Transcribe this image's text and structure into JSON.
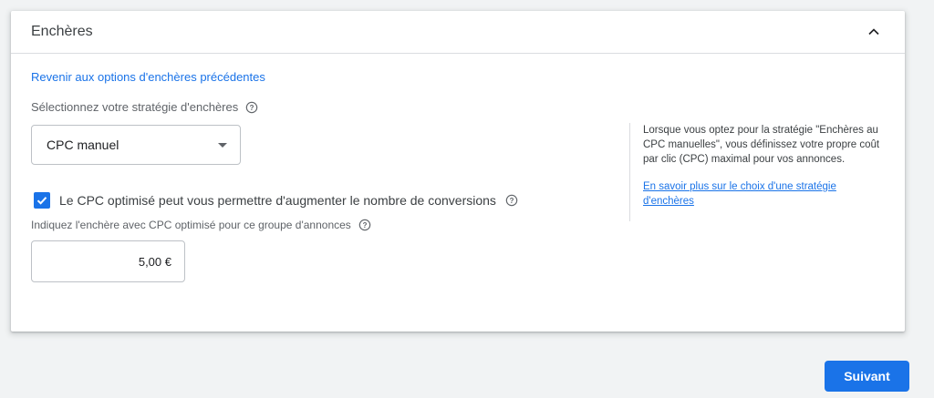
{
  "section": {
    "title": "Enchères",
    "collapse_icon": "chevron-up-icon"
  },
  "back_link": "Revenir aux options d'enchères précédentes",
  "strategy": {
    "label": "Sélectionnez votre stratégie d'enchères",
    "selected": "CPC manuel"
  },
  "ecpc": {
    "checked": true,
    "label": "Le CPC optimisé peut vous permettre d'augmenter le nombre de conversions"
  },
  "bid": {
    "label": "Indiquez l'enchère avec CPC optimisé pour ce groupe d'annonces",
    "value": "5,00 €"
  },
  "help_panel": {
    "text": "Lorsque vous optez pour la stratégie \"Enchères au CPC manuelles\", vous définissez votre propre coût par clic (CPC) maximal pour vos annonces.",
    "link": "En savoir plus sur le choix d'une stratégie d'enchères"
  },
  "footer": {
    "next_label": "Suivant"
  },
  "colors": {
    "accent": "#1a73e8",
    "background": "#f1f3f4"
  }
}
